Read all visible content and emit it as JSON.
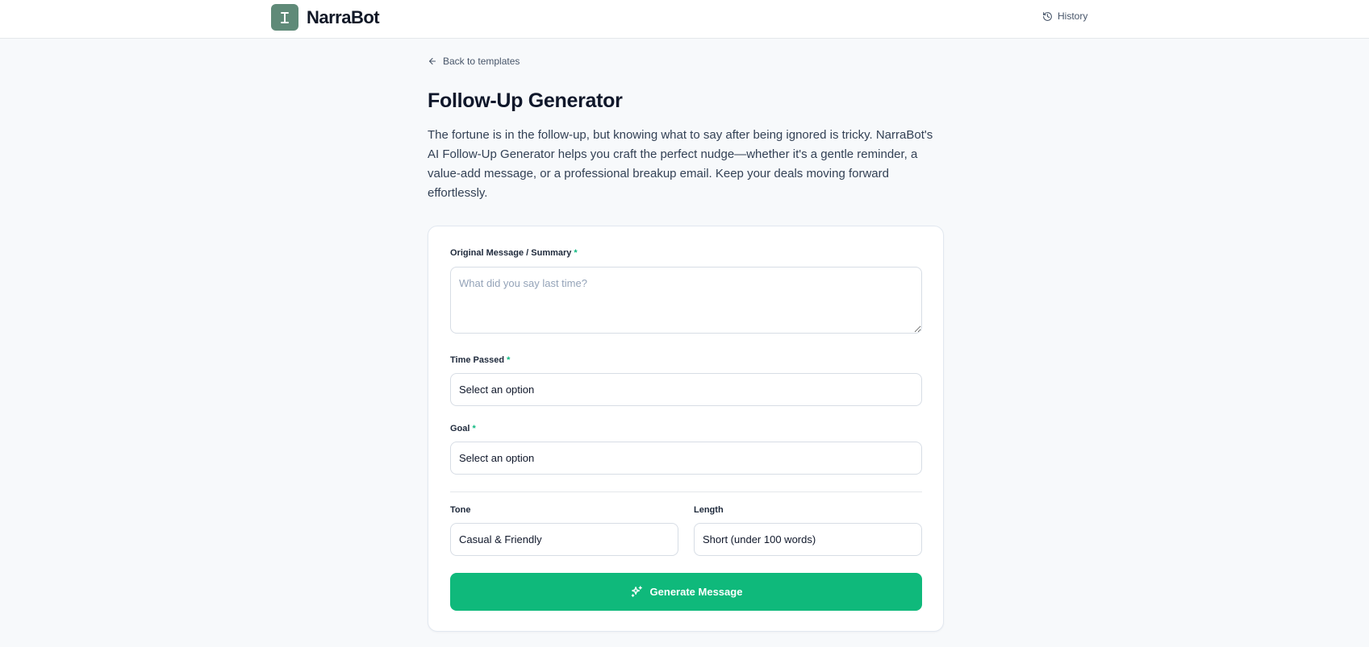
{
  "header": {
    "brand_name": "NarraBot",
    "logo_glyph": "I",
    "history_label": "History"
  },
  "nav": {
    "back_label": "Back to templates"
  },
  "page": {
    "title": "Follow-Up Generator",
    "description": "The fortune is in the follow-up, but knowing what to say after being ignored is tricky. NarraBot's AI Follow-Up Generator helps you craft the perfect nudge—whether it's a gentle reminder, a value-add message, or a professional breakup email. Keep your deals moving forward effortlessly."
  },
  "form": {
    "original_message": {
      "label": "Original Message / Summary",
      "required_mark": "*",
      "placeholder": "What did you say last time?",
      "value": ""
    },
    "time_passed": {
      "label": "Time Passed",
      "required_mark": "*",
      "value": "Select an option"
    },
    "goal": {
      "label": "Goal",
      "required_mark": "*",
      "value": "Select an option"
    },
    "tone": {
      "label": "Tone",
      "value": "Casual & Friendly"
    },
    "length": {
      "label": "Length",
      "value": "Short (under 100 words)"
    },
    "submit_label": "Generate Message"
  },
  "colors": {
    "accent": "#0fb97b",
    "logo_bg": "#5f8a78",
    "required": "#10b981"
  },
  "icons": {
    "history": "history-clock-icon",
    "back": "arrow-left-icon",
    "generate": "sparkles-icon",
    "resize": "resize-handle-icon"
  }
}
